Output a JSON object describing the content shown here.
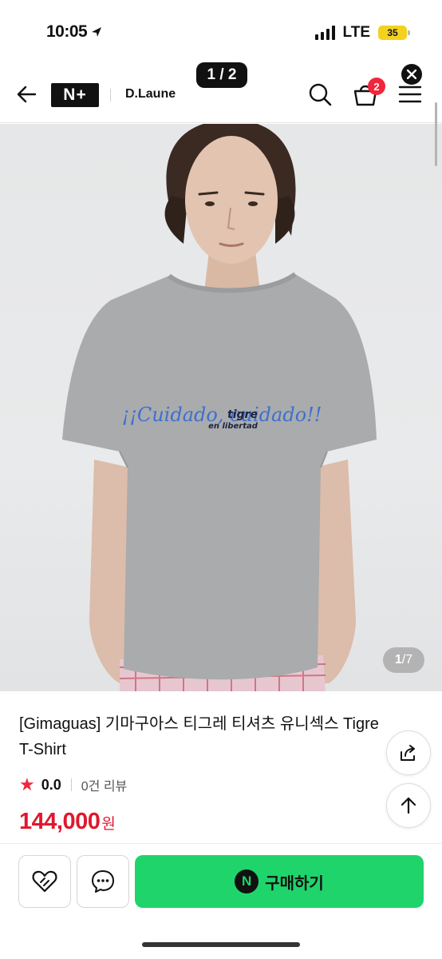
{
  "status_bar": {
    "time": "10:05",
    "network": "LTE",
    "battery": "35"
  },
  "header": {
    "logo": "N+",
    "brand": "D.Laune",
    "pager": "1 / 2",
    "cart_count": "2"
  },
  "image": {
    "counter_current": "1",
    "counter_total": "/7",
    "print_line1": "¡¡Cuidado, cuidado!!",
    "print_line2": "tigre",
    "print_line3": "en libertad"
  },
  "product": {
    "title": "[Gimaguas] 기마구아스 티그레 티셔츠 유니섹스 Tigre T-Shirt",
    "rating": "0.0",
    "review_count": "0건 리뷰",
    "price": "144,000",
    "price_unit": "원"
  },
  "actions": {
    "buy_label": "구매하기",
    "npay_glyph": "N"
  },
  "colors": {
    "accent_red": "#e0182d",
    "buy_green": "#1fd46b",
    "badge_red": "#f0263a",
    "shirt_gray": "#a9abad",
    "print_blue": "#3f6fd0"
  },
  "icons": [
    "back-arrow-icon",
    "search-icon",
    "cart-icon",
    "menu-icon",
    "close-icon",
    "share-icon",
    "arrow-up-icon",
    "heart-icon",
    "chat-icon",
    "star-icon"
  ]
}
